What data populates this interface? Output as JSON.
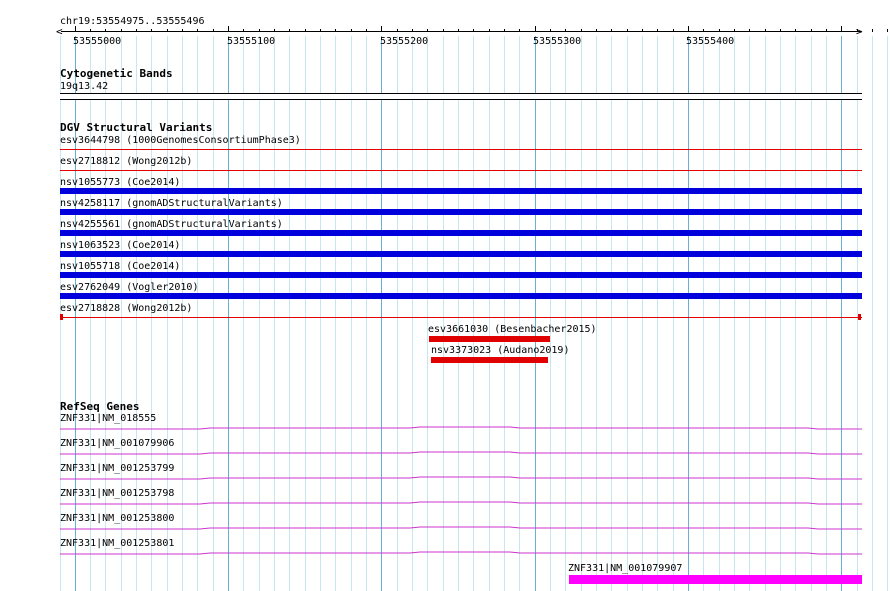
{
  "position": {
    "label": "chr19:53554975..53555496",
    "ticks": [
      "53555000",
      "53555100",
      "53555200",
      "53555300",
      "53555400"
    ]
  },
  "tracks": {
    "cytoband": {
      "title": "Cytogenetic Bands",
      "band": "19q13.42"
    },
    "dgv": {
      "title": "DGV Structural Variants",
      "features": [
        {
          "label": "esv3644798 (1000GenomesConsortiumPhase3)",
          "type": "loss"
        },
        {
          "label": "esv2718812 (Wong2012b)",
          "type": "loss"
        },
        {
          "label": "nsv1055773 (Coe2014)",
          "type": "gain"
        },
        {
          "label": "nsv4258117 (gnomADStructuralVariants)",
          "type": "gain"
        },
        {
          "label": "nsv4255561 (gnomADStructuralVariants)",
          "type": "gain"
        },
        {
          "label": "nsv1063523 (Coe2014)",
          "type": "gain"
        },
        {
          "label": "nsv1055718 (Coe2014)",
          "type": "gain"
        },
        {
          "label": "esv2762049 (Vogler2010)",
          "type": "gain"
        },
        {
          "label": "esv2718828 (Wong2012b)",
          "type": "loss"
        },
        {
          "label": "esv3661030 (Besenbacher2015)",
          "type": "loss"
        },
        {
          "label": "nsv3373023 (Audano2019)",
          "type": "loss"
        }
      ]
    },
    "refseq": {
      "title": "RefSeq Genes",
      "features": [
        {
          "label": "ZNF331|NM_018555"
        },
        {
          "label": "ZNF331|NM_001079906"
        },
        {
          "label": "ZNF331|NM_001253799"
        },
        {
          "label": "ZNF331|NM_001253798"
        },
        {
          "label": "ZNF331|NM_001253800"
        },
        {
          "label": "ZNF331|NM_001253801"
        },
        {
          "label": "ZNF331|NM_001079907"
        }
      ]
    }
  },
  "colors": {
    "grid_light": "#c8e6f0",
    "grid_dark": "#6ab0d4",
    "loss": "#e00000",
    "gain": "#0000dd",
    "gene_line": "#cc33cc",
    "gene_exon": "#ff00ff"
  }
}
